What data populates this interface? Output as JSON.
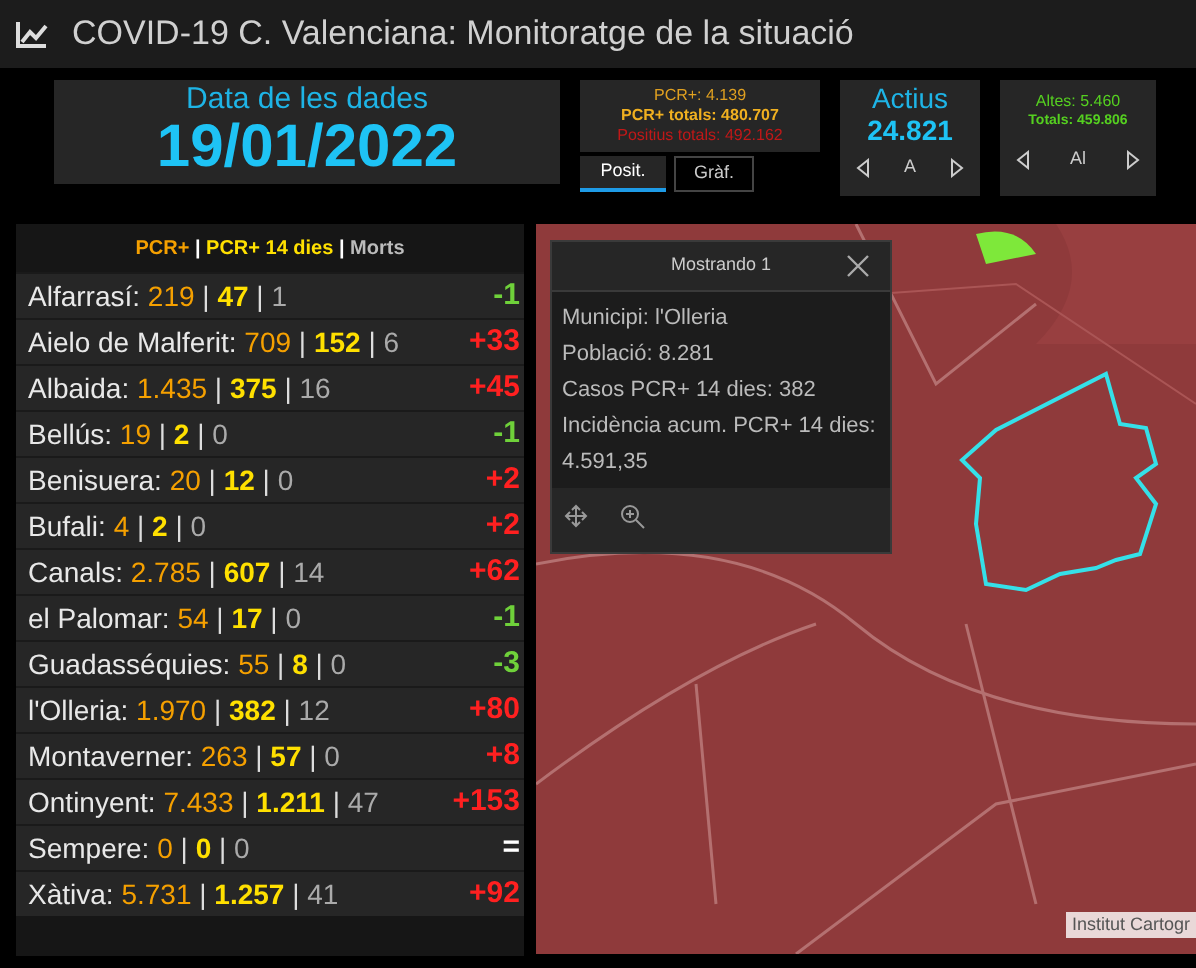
{
  "title": "COVID-19 C. Valenciana: Monitoratge de la situació",
  "date_card": {
    "label": "Data de les dades",
    "date": "19/01/2022"
  },
  "pcr_card": {
    "lines": [
      "PCR+: 4.139",
      "PCR+ totals: 480.707",
      "Positius totals: 492.162"
    ],
    "tabs": [
      {
        "label": "Posit.",
        "selected": true
      },
      {
        "label": "Gràf.",
        "selected": false
      }
    ]
  },
  "active_card": {
    "label": "Actius",
    "value": "24.821",
    "pager": "A"
  },
  "discharged_card": {
    "lines": [
      "Altes: 5.460",
      "Totals: 459.806"
    ],
    "pager": "Al"
  },
  "list": {
    "separator": "|",
    "legend": [
      "PCR+",
      "PCR+ 14 dies",
      "Morts"
    ],
    "rows": [
      {
        "name": "Alfarrasí:",
        "pcr": "219",
        "pcr14": "47",
        "deaths": "1",
        "change": "-1",
        "color": "#6fd13a"
      },
      {
        "name": "Aielo de Malferit:",
        "pcr": "709",
        "pcr14": "152",
        "deaths": "6",
        "change": "+33",
        "color": "#ff2020"
      },
      {
        "name": "Albaida:",
        "pcr": "1.435",
        "pcr14": "375",
        "deaths": "16",
        "change": "+45",
        "color": "#ff2020"
      },
      {
        "name": "Bellús:",
        "pcr": "19",
        "pcr14": "2",
        "deaths": "0",
        "change": "-1",
        "color": "#6fd13a"
      },
      {
        "name": "Benisuera:",
        "pcr": "20",
        "pcr14": "12",
        "deaths": "0",
        "change": "+2",
        "color": "#ff2020"
      },
      {
        "name": "Bufali:",
        "pcr": "4",
        "pcr14": "2",
        "deaths": "0",
        "change": "+2",
        "color": "#ff2020"
      },
      {
        "name": "Canals:",
        "pcr": "2.785",
        "pcr14": "607",
        "deaths": "14",
        "change": "+62",
        "color": "#ff2020"
      },
      {
        "name": "el Palomar:",
        "pcr": "54",
        "pcr14": "17",
        "deaths": "0",
        "change": "-1",
        "color": "#6fd13a"
      },
      {
        "name": "Guadasséquies:",
        "pcr": "55",
        "pcr14": "8",
        "deaths": "0",
        "change": "-3",
        "color": "#6fd13a"
      },
      {
        "name": "l'Olleria:",
        "pcr": "1.970",
        "pcr14": "382",
        "deaths": "12",
        "change": "+80",
        "color": "#ff2020"
      },
      {
        "name": "Montaverner:",
        "pcr": "263",
        "pcr14": "57",
        "deaths": "0",
        "change": "+8",
        "color": "#ff2020"
      },
      {
        "name": "Ontinyent:",
        "pcr": "7.433",
        "pcr14": "1.211",
        "deaths": "47",
        "change": "+153",
        "color": "#ff2020"
      },
      {
        "name": "Sempere:",
        "pcr": "0",
        "pcr14": "0",
        "deaths": "0",
        "change": "=",
        "color": "#ffffff"
      },
      {
        "name": "Xàtiva:",
        "pcr": "5.731",
        "pcr14": "1.257",
        "deaths": "41",
        "change": "+92",
        "color": "#ff2020"
      }
    ]
  },
  "map": {
    "popup": {
      "title": "Mostrando 1",
      "lines": [
        "Municipi: l'Olleria",
        "Població: 8.281",
        "Casos PCR+ 14 dies: 382",
        "Incidència acum. PCR+ 14 dies: 4.591,35"
      ]
    },
    "attribution": "Institut Cartogr"
  }
}
